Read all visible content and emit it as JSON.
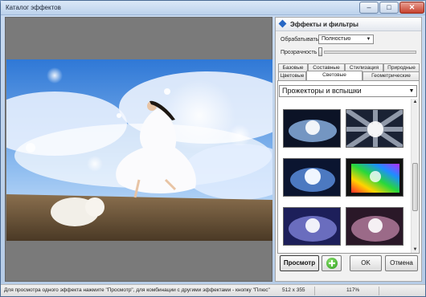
{
  "window": {
    "title": "Каталог эффектов",
    "min_glyph": "–",
    "max_glyph": "□",
    "close_glyph": "✕"
  },
  "panel": {
    "header": "Эффекты и фильтры",
    "process_label": "Обрабатывать",
    "process_value": "Полностью",
    "opacity_label": "Прозрачность",
    "opacity_value": 0.0,
    "tabs_row1": [
      "Базовые",
      "Составные",
      "Стилизация",
      "Природные"
    ],
    "tabs_row2": [
      "Цветовые",
      "Световые",
      "Геометрические"
    ],
    "active_tab": "Световые",
    "group_value": "Прожекторы и вспышки",
    "dropdown_glyph": "▼",
    "scroll_up_glyph": "▲",
    "scroll_down_glyph": "▼"
  },
  "buttons": {
    "preview": "Просмотр",
    "ok": "OK",
    "cancel": "Отмена"
  },
  "status": {
    "hint": "Для просмотра одного эффекта нажмите \"Просмотр\", для комбинации с другими эффектами - кнопку \"Плюс\"",
    "size": "512 x 355",
    "zoom": "117%"
  },
  "icons": [
    "minimize-icon",
    "maximize-icon",
    "close-icon",
    "panel-diamond-icon",
    "dropdown-arrow-icon",
    "plus-icon"
  ],
  "colors": {
    "title_bar": "#c8daf0",
    "close_button": "#c6402d",
    "plus_button": "#2a9a1c",
    "preview_bg": "#7a7a7a"
  }
}
